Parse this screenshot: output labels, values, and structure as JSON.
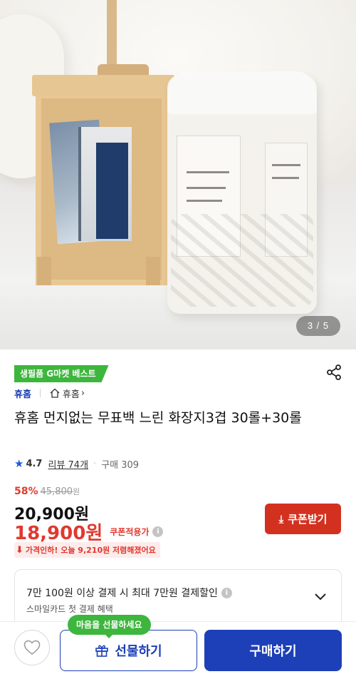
{
  "gallery": {
    "counter": "3 / 5"
  },
  "badge": "생필품 G마켓 베스트",
  "brand": {
    "name": "휴홈",
    "shop_label": "휴홈"
  },
  "product": {
    "title": "휴홈 먼지없는 무표백 느린 화장지3겹 30롤+30롤",
    "rating": "4.7",
    "review_label": "리뷰 74개",
    "purchase_label": "구매 309"
  },
  "price": {
    "discount_pct": "58%",
    "original": "45,800",
    "original_unit": "원",
    "sale": "20,900원",
    "coupon_price": "18,900원",
    "coupon_note": "쿠폰적용가",
    "info_icon_glyph": "i",
    "drop_text": "가격인하! 오늘 9,210원 저렴해졌어요"
  },
  "coupon_button": {
    "label": "쿠폰받기",
    "icon": "download-icon"
  },
  "card_benefit": {
    "title": "7만 100원 이상 결제 시 최대 7만원 결제할인",
    "subtitle": "스마일카드 첫 결제 혜택"
  },
  "bottom_bar": {
    "tooltip": "마음을 선물하세요",
    "gift_label": "선물하기",
    "buy_label": "구매하기"
  },
  "colors": {
    "accent_blue": "#1d3fb8",
    "sale_red": "#e0392f",
    "badge_green": "#3db63d",
    "coupon_red": "#d3311f"
  },
  "icons": [
    "share-icon",
    "home-icon",
    "star-icon",
    "info-icon",
    "download-icon",
    "chevron-down-icon",
    "heart-icon",
    "gift-icon"
  ]
}
